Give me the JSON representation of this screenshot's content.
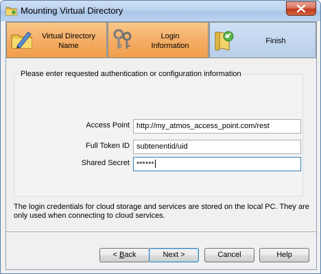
{
  "window": {
    "title": "Mounting Virtual Directory"
  },
  "steps": [
    {
      "label_line1": "Virtual Directory",
      "label_line2": "Name"
    },
    {
      "label_line1": "Login",
      "label_line2": "Information"
    },
    {
      "label_line1": "Finish"
    }
  ],
  "form": {
    "caption": "Please enter requested authentication or configuration information",
    "access_point": {
      "label": "Access Point",
      "value": "http://my_atmos_access_point.com/rest"
    },
    "full_token_id": {
      "label": "Full Token ID",
      "value": "subtenentid/uid"
    },
    "shared_secret": {
      "label": "Shared Secret",
      "value": "******"
    }
  },
  "note": "The login credentials for cloud storage and services are stored on the local PC. They are only used when connecting to cloud services.",
  "buttons": {
    "back_prefix": "< ",
    "back_mnemonic": "B",
    "back_rest": "ack",
    "next": "Next >",
    "cancel": "Cancel",
    "help": "Help"
  },
  "colors": {
    "step_done": "#f5b06a",
    "step_active": "#b8cfe9",
    "titlebar": "#b9d1ee"
  }
}
